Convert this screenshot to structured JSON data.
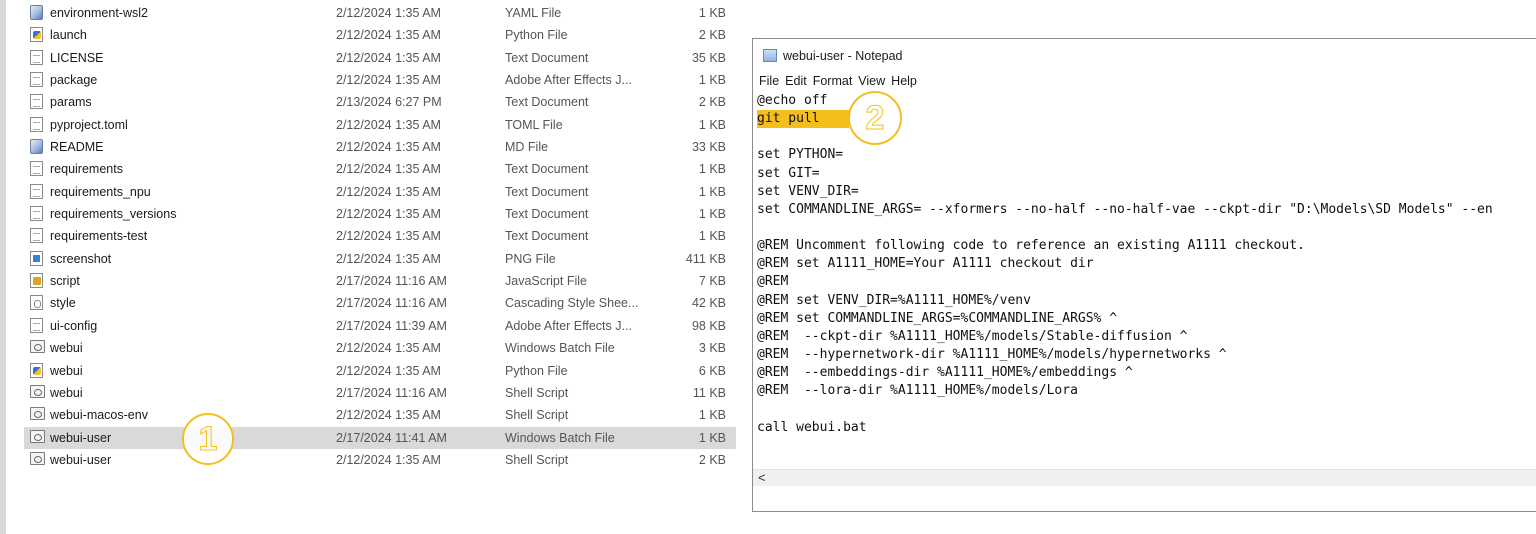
{
  "files": [
    {
      "name": "environment-wsl2",
      "date": "2/12/2024 1:35 AM",
      "type": "YAML File",
      "size": "1 KB",
      "icon": "yaml-file-icon"
    },
    {
      "name": "launch",
      "date": "2/12/2024 1:35 AM",
      "type": "Python File",
      "size": "2 KB",
      "icon": "python-file-icon"
    },
    {
      "name": "LICENSE",
      "date": "2/12/2024 1:35 AM",
      "type": "Text Document",
      "size": "35 KB",
      "icon": "text-file-icon"
    },
    {
      "name": "package",
      "date": "2/12/2024 1:35 AM",
      "type": "Adobe After Effects J...",
      "size": "1 KB",
      "icon": "json-file-icon"
    },
    {
      "name": "params",
      "date": "2/13/2024 6:27 PM",
      "type": "Text Document",
      "size": "2 KB",
      "icon": "text-file-icon"
    },
    {
      "name": "pyproject.toml",
      "date": "2/12/2024 1:35 AM",
      "type": "TOML File",
      "size": "1 KB",
      "icon": "generic-file-icon"
    },
    {
      "name": "README",
      "date": "2/12/2024 1:35 AM",
      "type": "MD File",
      "size": "33 KB",
      "icon": "md-file-icon"
    },
    {
      "name": "requirements",
      "date": "2/12/2024 1:35 AM",
      "type": "Text Document",
      "size": "1 KB",
      "icon": "text-file-icon"
    },
    {
      "name": "requirements_npu",
      "date": "2/12/2024 1:35 AM",
      "type": "Text Document",
      "size": "1 KB",
      "icon": "text-file-icon"
    },
    {
      "name": "requirements_versions",
      "date": "2/12/2024 1:35 AM",
      "type": "Text Document",
      "size": "1 KB",
      "icon": "text-file-icon"
    },
    {
      "name": "requirements-test",
      "date": "2/12/2024 1:35 AM",
      "type": "Text Document",
      "size": "1 KB",
      "icon": "text-file-icon"
    },
    {
      "name": "screenshot",
      "date": "2/12/2024 1:35 AM",
      "type": "PNG File",
      "size": "411 KB",
      "icon": "png-file-icon"
    },
    {
      "name": "script",
      "date": "2/17/2024 11:16 AM",
      "type": "JavaScript File",
      "size": "7 KB",
      "icon": "js-file-icon"
    },
    {
      "name": "style",
      "date": "2/17/2024 11:16 AM",
      "type": "Cascading Style Shee...",
      "size": "42 KB",
      "icon": "css-file-icon"
    },
    {
      "name": "ui-config",
      "date": "2/17/2024 11:39 AM",
      "type": "Adobe After Effects J...",
      "size": "98 KB",
      "icon": "json-file-icon"
    },
    {
      "name": "webui",
      "date": "2/12/2024 1:35 AM",
      "type": "Windows Batch File",
      "size": "3 KB",
      "icon": "batch-file-icon"
    },
    {
      "name": "webui",
      "date": "2/12/2024 1:35 AM",
      "type": "Python File",
      "size": "6 KB",
      "icon": "python-file-icon"
    },
    {
      "name": "webui",
      "date": "2/17/2024 11:16 AM",
      "type": "Shell Script",
      "size": "11 KB",
      "icon": "shell-file-icon"
    },
    {
      "name": "webui-macos-env",
      "date": "2/12/2024 1:35 AM",
      "type": "Shell Script",
      "size": "1 KB",
      "icon": "shell-file-icon"
    },
    {
      "name": "webui-user",
      "date": "2/17/2024 11:41 AM",
      "type": "Windows Batch File",
      "size": "1 KB",
      "icon": "batch-file-icon",
      "selected": true
    },
    {
      "name": "webui-user",
      "date": "2/12/2024 1:35 AM",
      "type": "Shell Script",
      "size": "2 KB",
      "icon": "shell-file-icon"
    }
  ],
  "badges": {
    "one": "1",
    "two": "2"
  },
  "notepad": {
    "title": "webui-user - Notepad",
    "menu": [
      "File",
      "Edit",
      "Format",
      "View",
      "Help"
    ],
    "lines": [
      "@echo off",
      "git pull",
      "",
      "set PYTHON=",
      "set GIT=",
      "set VENV_DIR=",
      "set COMMANDLINE_ARGS= --xformers --no-half --no-half-vae --ckpt-dir \"D:\\Models\\SD Models\" --en",
      "",
      "@REM Uncomment following code to reference an existing A1111 checkout.",
      "@REM set A1111_HOME=Your A1111 checkout dir",
      "@REM",
      "@REM set VENV_DIR=%A1111_HOME%/venv",
      "@REM set COMMANDLINE_ARGS=%COMMANDLINE_ARGS% ^",
      "@REM  --ckpt-dir %A1111_HOME%/models/Stable-diffusion ^",
      "@REM  --hypernetwork-dir %A1111_HOME%/models/hypernetworks ^",
      "@REM  --embeddings-dir %A1111_HOME%/embeddings ^",
      "@REM  --lora-dir %A1111_HOME%/models/Lora",
      "",
      "call webui.bat"
    ],
    "highlighted_line": 1,
    "scroll_left_arrow": "<"
  },
  "colors": {
    "highlight": "#f6be1a",
    "badge": "#f2c01e",
    "selected_row": "#d9d9d9"
  }
}
